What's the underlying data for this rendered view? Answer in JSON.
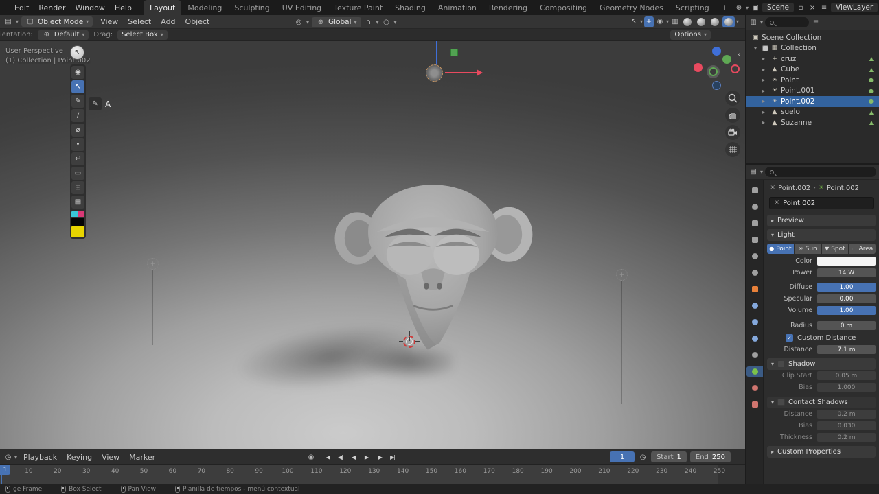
{
  "colors": {
    "accent": "#4772b3",
    "selection": "#33639e",
    "object_orange": "#e8813a",
    "data_green": "#7cc24a"
  },
  "topbar": {
    "menus": [
      "Edit",
      "Render",
      "Window",
      "Help"
    ],
    "tabs": [
      "Layout",
      "Modeling",
      "Sculpting",
      "UV Editing",
      "Texture Paint",
      "Shading",
      "Animation",
      "Rendering",
      "Compositing",
      "Geometry Nodes",
      "Scripting"
    ],
    "active_tab": "Layout",
    "add_tab": "+",
    "scene_label": "Scene",
    "view_layer_label": "ViewLayer"
  },
  "viewport_header": {
    "mode": "Object Mode",
    "menus": [
      "View",
      "Select",
      "Add",
      "Object"
    ],
    "orientation": "Global",
    "options_label": "Options"
  },
  "tool_settings": {
    "orientation_label": "ientation:",
    "orientation_value": "Default",
    "drag_label": "Drag:",
    "drag_value": "Select Box"
  },
  "viewport": {
    "overlay_line1": "User Perspective",
    "overlay_line2": "(1) Collection | Point.002",
    "annotate_letter": "A"
  },
  "toolbar": {
    "tools": [
      {
        "name": "select-tweak",
        "glyph": "◉",
        "active": false
      },
      {
        "name": "select-box",
        "glyph": "↖",
        "active": true
      },
      {
        "name": "annotate",
        "glyph": "✎",
        "active": false
      },
      {
        "name": "measure",
        "glyph": "∕",
        "active": false
      },
      {
        "name": "cursor",
        "glyph": "⌀",
        "active": false
      },
      {
        "name": "move",
        "glyph": "•",
        "active": false
      },
      {
        "name": "rotate",
        "glyph": "↩",
        "active": false
      },
      {
        "name": "scale",
        "glyph": "▭",
        "active": false
      },
      {
        "name": "transform",
        "glyph": "⊞",
        "active": false
      },
      {
        "name": "add-object",
        "glyph": "▤",
        "active": false
      }
    ]
  },
  "outliner": {
    "root_label": "Scene Collection",
    "collection_label": "Collection",
    "items": [
      {
        "label": "cruz",
        "type": "empty",
        "selected": false
      },
      {
        "label": "Cube",
        "type": "mesh",
        "selected": false
      },
      {
        "label": "Point",
        "type": "light",
        "selected": false
      },
      {
        "label": "Point.001",
        "type": "light",
        "selected": false
      },
      {
        "label": "Point.002",
        "type": "light",
        "selected": true
      },
      {
        "label": "suelo",
        "type": "mesh",
        "selected": false
      },
      {
        "label": "Suzanne",
        "type": "mesh",
        "selected": false
      }
    ]
  },
  "properties": {
    "tabs": [
      {
        "name": "tool",
        "shape": "sq",
        "color": "#a0a0a0",
        "active": false
      },
      {
        "name": "render",
        "shape": "dot",
        "color": "#a0a0a0",
        "active": false
      },
      {
        "name": "output",
        "shape": "sq",
        "color": "#a0a0a0",
        "active": false
      },
      {
        "name": "view-layer",
        "shape": "sq",
        "color": "#a0a0a0",
        "active": false
      },
      {
        "name": "scene",
        "shape": "dot",
        "color": "#a0a0a0",
        "active": false
      },
      {
        "name": "world",
        "shape": "dot",
        "color": "#a0a0a0",
        "active": false
      },
      {
        "name": "object",
        "shape": "sq",
        "color": "#e8813a",
        "active": false
      },
      {
        "name": "modifiers",
        "shape": "dot",
        "color": "#84a8dc",
        "active": false
      },
      {
        "name": "particles",
        "shape": "dot",
        "color": "#84a8dc",
        "active": false
      },
      {
        "name": "physics",
        "shape": "dot",
        "color": "#84a8dc",
        "active": false
      },
      {
        "name": "object-constraints",
        "shape": "dot",
        "color": "#a0a0a0",
        "active": false
      },
      {
        "name": "object-data",
        "shape": "dot",
        "color": "#7cc24a",
        "active": true
      },
      {
        "name": "material",
        "shape": "dot",
        "color": "#d0756f",
        "active": false
      },
      {
        "name": "texture",
        "shape": "sq",
        "color": "#d0756f",
        "active": false
      }
    ],
    "breadcrumb_object": "Point.002",
    "breadcrumb_data": "Point.002",
    "name_value": "Point.002",
    "preview_label": "Preview",
    "light_label": "Light",
    "light_types": [
      {
        "label": "Point",
        "glyph": "●"
      },
      {
        "label": "Sun",
        "glyph": "☀"
      },
      {
        "label": "Spot",
        "glyph": "▼"
      },
      {
        "label": "Area",
        "glyph": "▭"
      }
    ],
    "active_light_type": "Point",
    "color_label": "Color",
    "power_label": "Power",
    "power_value": "14 W",
    "diffuse_label": "Diffuse",
    "diffuse_value": "1.00",
    "specular_label": "Specular",
    "specular_value": "0.00",
    "volume_label": "Volume",
    "volume_value": "1.00",
    "radius_label": "Radius",
    "radius_value": "0 m",
    "custom_distance_label": "Custom Distance",
    "distance_label": "Distance",
    "distance_value": "7.1 m",
    "shadow_label": "Shadow",
    "clip_start_label": "Clip Start",
    "clip_start_value": "0.05 m",
    "bias_label": "Bias",
    "bias_value": "1.000",
    "contact_shadows_label": "Contact Shadows",
    "contact_distance_label": "Distance",
    "contact_distance_value": "0.2 m",
    "contact_bias_label": "Bias",
    "contact_bias_value": "0.030",
    "thickness_label": "Thickness",
    "thickness_value": "0.2 m",
    "custom_properties_label": "Custom Properties"
  },
  "timeline": {
    "menus": [
      "Playback",
      "Keying",
      "View",
      "Marker"
    ],
    "buttons": [
      {
        "name": "jump-to-start",
        "glyph": "|◀"
      },
      {
        "name": "previous-keyframe",
        "glyph": "◀|"
      },
      {
        "name": "previous-frame",
        "glyph": "◀"
      },
      {
        "name": "play",
        "glyph": "▶"
      },
      {
        "name": "next-keyframe",
        "glyph": "|▶"
      },
      {
        "name": "jump-to-end",
        "glyph": "▶|"
      }
    ],
    "current_frame": "1",
    "playhead_label": "1",
    "start_label": "Start",
    "start_value": "1",
    "end_label": "End",
    "end_value": "250",
    "ticks": [
      10,
      20,
      30,
      40,
      50,
      60,
      70,
      80,
      90,
      100,
      110,
      120,
      130,
      140,
      150,
      160,
      170,
      180,
      190,
      200,
      210,
      220,
      230,
      240,
      250
    ]
  },
  "statusbar": {
    "items": [
      {
        "label": "ge Frame",
        "mouse": "left"
      },
      {
        "label": "Box Select",
        "mouse": "left"
      },
      {
        "label": "Pan View",
        "mouse": "middle"
      },
      {
        "label": "Planilla de tiempos - menú contextual",
        "mouse": "right"
      }
    ]
  }
}
